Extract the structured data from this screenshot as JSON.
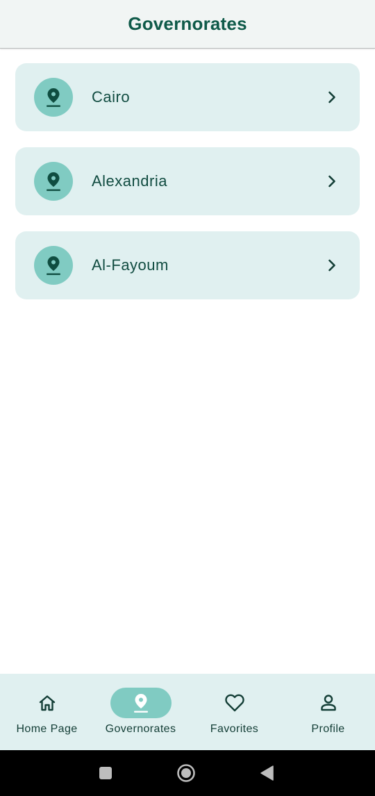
{
  "app_bar": {
    "title": "Governorates"
  },
  "governorates": [
    {
      "name": "Cairo",
      "icon": "location-pin-icon"
    },
    {
      "name": "Alexandria",
      "icon": "location-pin-icon"
    },
    {
      "name": "Al-Fayoum",
      "icon": "location-pin-icon"
    }
  ],
  "bottom_nav": {
    "active": "Governorates",
    "items": [
      {
        "label": "Home Page",
        "icon": "home-icon"
      },
      {
        "label": "Governorates",
        "icon": "location-pin-icon"
      },
      {
        "label": "Favorites",
        "icon": "heart-icon"
      },
      {
        "label": "Profile",
        "icon": "person-icon"
      }
    ]
  },
  "system_nav": {
    "buttons": [
      "recents-button",
      "home-button",
      "back-button"
    ]
  },
  "colors": {
    "primary_dark": "#0f5a49",
    "card_background": "#e0f0f0",
    "accent": "#80cbc2",
    "app_bar_background": "#f1f5f4",
    "system_bar": "#000000"
  }
}
